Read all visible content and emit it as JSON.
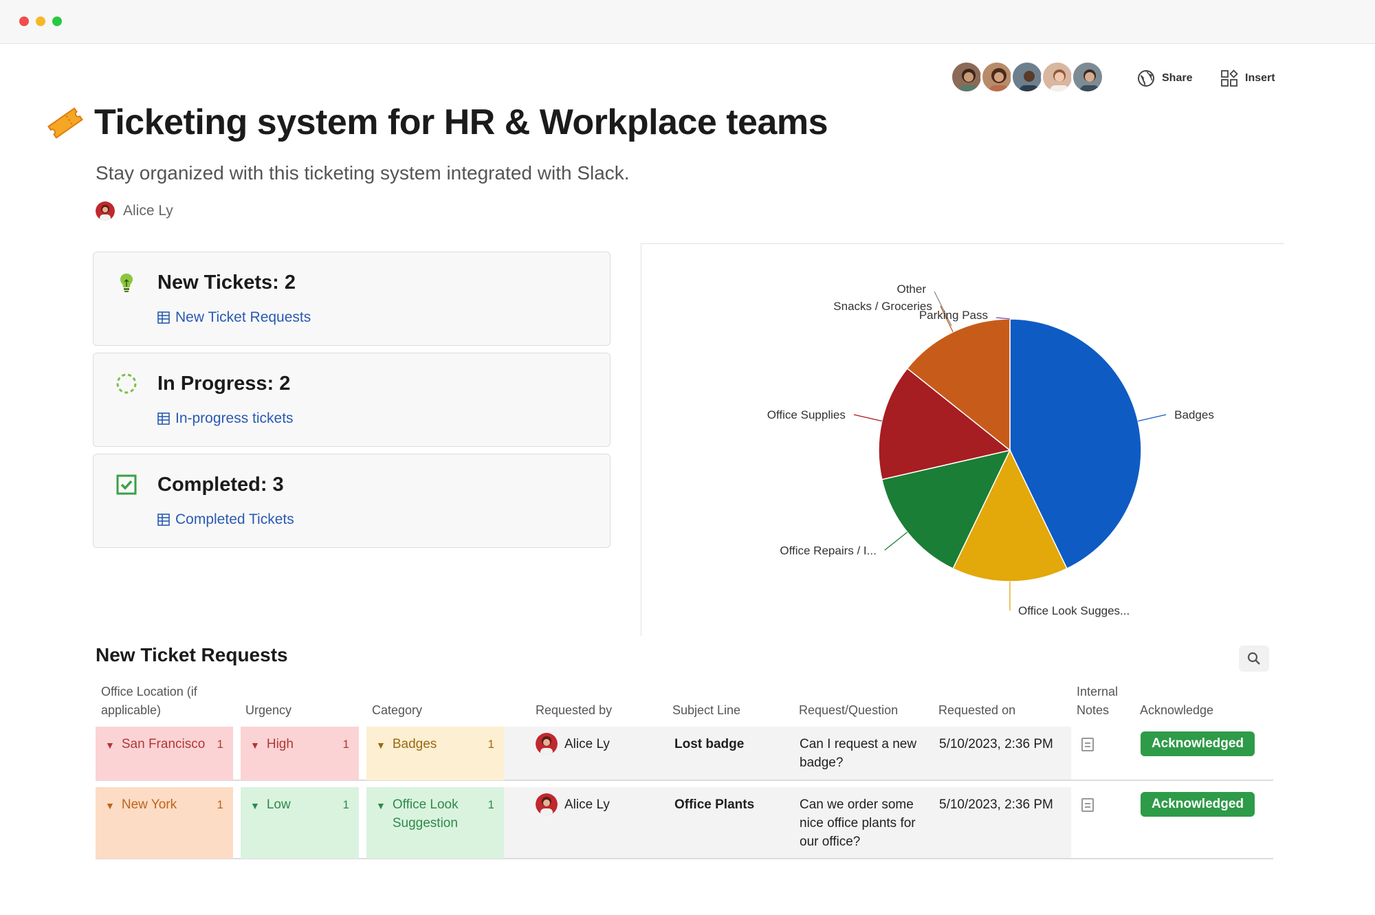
{
  "window": {
    "dots": [
      "#ee4e4e",
      "#f5b82a",
      "#28c840"
    ]
  },
  "header": {
    "share_label": "Share",
    "insert_label": "Insert",
    "avatar_count": 5
  },
  "doc": {
    "title": "Ticketing system for HR & Workplace teams",
    "subtitle": "Stay organized with this ticketing system integrated with Slack.",
    "author": "Alice Ly"
  },
  "cards": [
    {
      "icon": "lightbulb-icon",
      "title": "New Tickets:  2",
      "link": "New Ticket Requests"
    },
    {
      "icon": "progress-spinner-icon",
      "title": "In Progress: 2",
      "link": "In-progress tickets"
    },
    {
      "icon": "checkbox-checked-icon",
      "title": "Completed:  3",
      "link": "Completed Tickets"
    }
  ],
  "chart_data": {
    "type": "pie",
    "slices": [
      {
        "label": "Badges",
        "value": 3,
        "color": "#0f5bc4"
      },
      {
        "label": "Office Look Sugges...",
        "value": 1,
        "color": "#e3a80a"
      },
      {
        "label": "Office Repairs / I...",
        "value": 1,
        "color": "#1a7e36"
      },
      {
        "label": "Office Supplies",
        "value": 1,
        "color": "#a61d22"
      },
      {
        "label": "Snacks / Groceries",
        "value": 1,
        "color": "#c75c1a"
      },
      {
        "label": "Other",
        "value": 0,
        "color": "#8a8a8a"
      },
      {
        "label": "Parking Pass",
        "value": 0,
        "color": "#7a3ea8"
      }
    ]
  },
  "table": {
    "title": "New Ticket Requests",
    "columns": [
      "Office Location (if applicable)",
      "Urgency",
      "Category",
      "Requested by",
      "Subject Line",
      "Request/Question",
      "Requested on",
      "Internal Notes",
      "Acknowledge"
    ],
    "rows": [
      {
        "location": "San Francisco",
        "location_count": "1",
        "urgency": "High",
        "urgency_count": "1",
        "category": "Badges",
        "category_count": "1",
        "requested_by": "Alice Ly",
        "subject": "Lost badge",
        "question": "Can I request a new badge?",
        "requested_on": "5/10/2023, 2:36 PM",
        "ack": "Acknowledged"
      },
      {
        "location": "New York",
        "location_count": "1",
        "urgency": "Low",
        "urgency_count": "1",
        "category": "Office Look Suggestion",
        "category_count": "1",
        "requested_by": "Alice Ly",
        "subject": "Office Plants",
        "question": "Can we order some nice office plants for our office?",
        "requested_on": "5/10/2023, 2:36 PM",
        "ack": "Acknowledged"
      }
    ]
  }
}
